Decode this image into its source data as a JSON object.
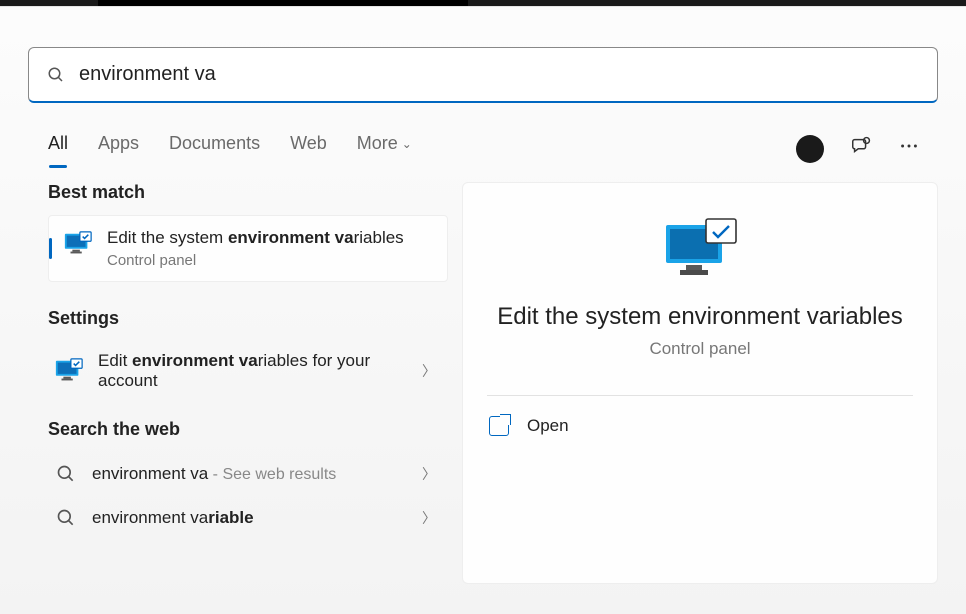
{
  "search": {
    "value": "environment va"
  },
  "tabs": {
    "all": "All",
    "apps": "Apps",
    "documents": "Documents",
    "web": "Web",
    "more": "More"
  },
  "left": {
    "best_match_header": "Best match",
    "best_match": {
      "title_prefix": "Edit the system ",
      "title_bold": "environment va",
      "title_suffix": "riables",
      "subtitle": "Control panel"
    },
    "settings_header": "Settings",
    "settings_item": {
      "title_prefix": "Edit ",
      "title_bold": "environment va",
      "title_suffix": "riables for your account"
    },
    "web_header": "Search the web",
    "web_items": [
      {
        "query": "environment va",
        "hint": " - See web results"
      },
      {
        "query_prefix": "environment va",
        "query_bold": "riable",
        "query_suffix": ""
      }
    ]
  },
  "detail": {
    "title": "Edit the system environment variables",
    "subtitle": "Control panel",
    "open_label": "Open"
  }
}
